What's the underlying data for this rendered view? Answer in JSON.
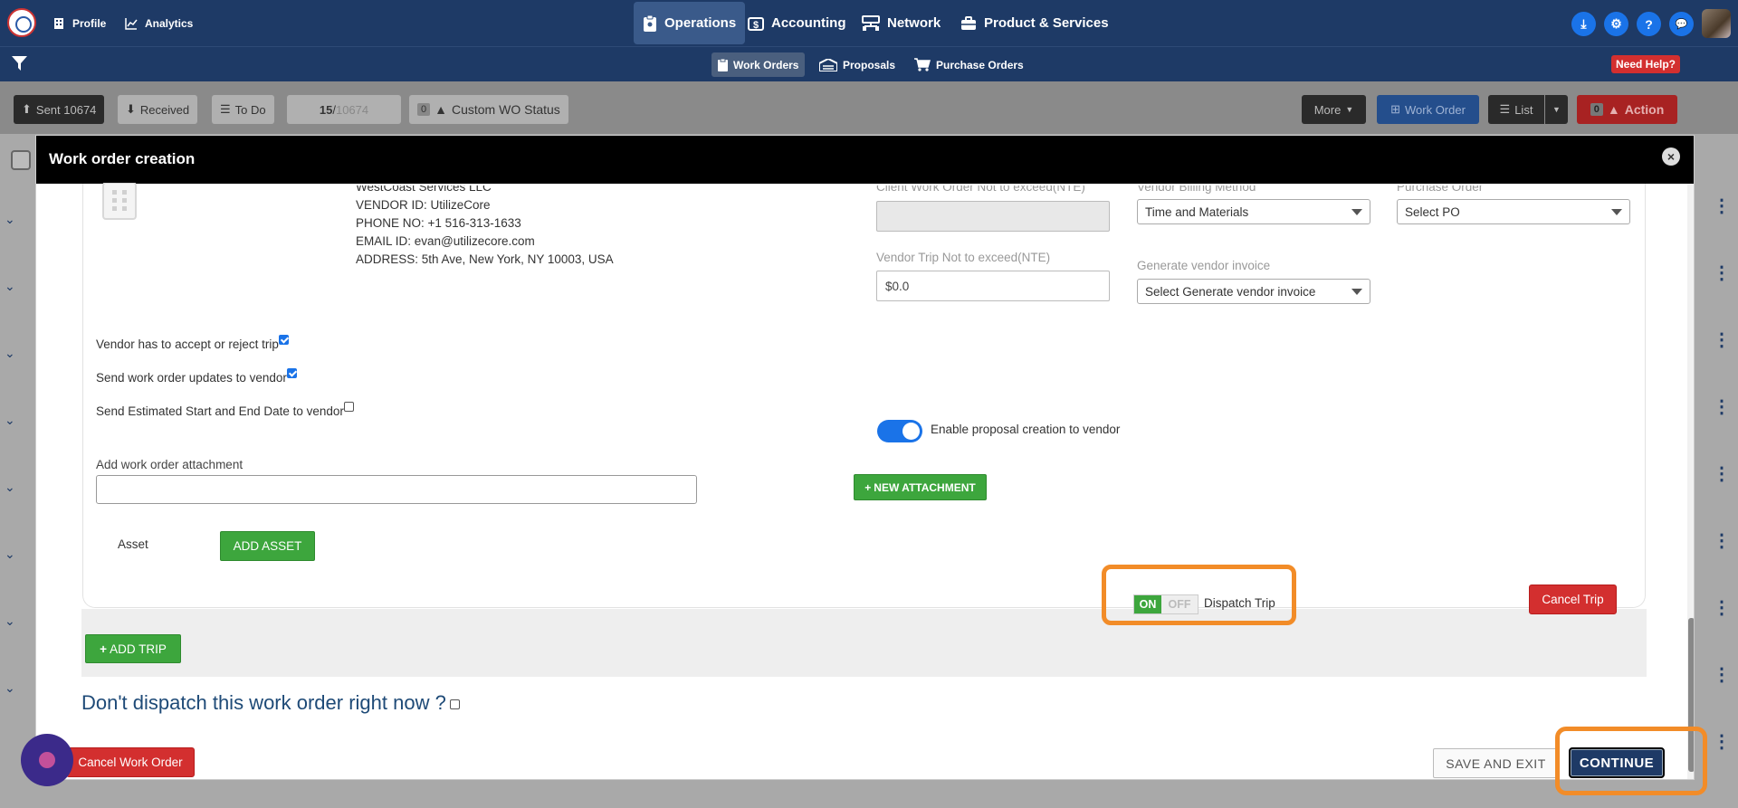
{
  "topnav": {
    "left": [
      {
        "label": "Profile",
        "icon": "building-icon"
      },
      {
        "label": "Analytics",
        "icon": "line-chart-icon"
      }
    ],
    "center": [
      {
        "label": "Operations",
        "icon": "clipboard-icon",
        "active": true
      },
      {
        "label": "Accounting",
        "icon": "dollar-box-icon"
      },
      {
        "label": "Network",
        "icon": "network-icon"
      },
      {
        "label": "Product & Services",
        "icon": "briefcase-icon"
      }
    ],
    "right_icons": [
      "download-circle-icon",
      "gear-icon",
      "question-icon",
      "chat-icon"
    ],
    "right_glyphs": [
      "⤓",
      "⚙",
      "?",
      "💬"
    ]
  },
  "subnav": {
    "items": [
      {
        "label": "Work Orders",
        "icon": "clipboard-icon",
        "active": true
      },
      {
        "label": "Proposals",
        "icon": "proposal-icon"
      },
      {
        "label": "Purchase Orders",
        "icon": "cart-icon"
      }
    ],
    "help": "Need Help?"
  },
  "toolbar": {
    "sent": "Sent 10674",
    "received": "Received",
    "todo": "To Do",
    "count_current": "15",
    "count_sep": " / ",
    "count_total": "10674",
    "custom_badge": "0",
    "custom_status": "Custom WO Status",
    "more": "More",
    "work_order": "Work Order",
    "list": "List",
    "action_badge": "0",
    "action": "Action"
  },
  "modal": {
    "title": "Work order creation",
    "close": "×",
    "vendor": {
      "name": "WestCoast Services LLC",
      "id": "VENDOR ID: UtilizeCore",
      "phone": "PHONE NO: +1 516-313-1633",
      "email": "EMAIL ID: evan@utilizecore.com",
      "address": "ADDRESS: 5th Ave, New York, NY 10003, USA"
    },
    "fields": {
      "client_nte_label": "Client Work Order Not to exceed(NTE)",
      "client_nte_value": "",
      "vendor_billing_label": "Vendor Billing Method",
      "vendor_billing_value": "Time and Materials",
      "purchase_order_label": "Purchase Order",
      "purchase_order_value": "Select PO",
      "trip_nte_label": "Vendor Trip Not to exceed(NTE)",
      "trip_nte_value": "$0.0",
      "gen_invoice_label": "Generate vendor invoice",
      "gen_invoice_value": "Select Generate vendor invoice"
    },
    "checks": [
      {
        "label": "Vendor has to accept or reject trip",
        "checked": true
      },
      {
        "label": "Send work order updates to vendor",
        "checked": true
      },
      {
        "label": "Send Estimated Start and End Date to vendor",
        "checked": false
      }
    ],
    "proposal_toggle": {
      "label": "Enable proposal creation to vendor",
      "on": true
    },
    "attachment_label": "Add work order attachment",
    "new_attachment": "NEW ATTACHMENT",
    "asset_label": "Asset",
    "add_asset": "ADD ASSET",
    "dispatch": {
      "on": "ON",
      "off": "OFF",
      "label": "Dispatch Trip"
    },
    "cancel_trip": "Cancel Trip",
    "add_trip": "ADD TRIP",
    "dont_dispatch": "Don't dispatch this work order right now ?",
    "cancel_wo": "Cancel Work Order",
    "save_exit": "SAVE AND EXIT",
    "continue": "CONTINUE"
  },
  "colors": {
    "nav": "#1e3a66",
    "primary": "#1a73e8",
    "success": "#3da63d",
    "danger": "#d32f2f",
    "highlight": "#f28c28"
  }
}
